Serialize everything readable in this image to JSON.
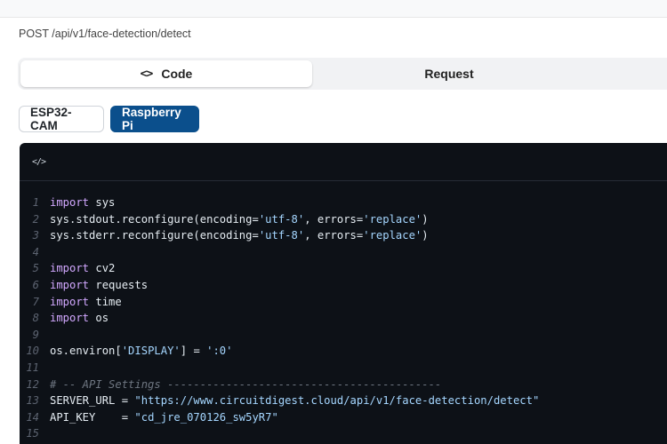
{
  "endpoint": "POST /api/v1/face-detection/detect",
  "tabs": {
    "code_icon": "<>",
    "code_label": "Code",
    "request_label": "Request"
  },
  "devices": {
    "esp32": "ESP32-CAM",
    "raspberry": "Raspberry Pi"
  },
  "code_header_icon": "</>",
  "colors": {
    "active_button": "#0b4f8c",
    "code_bg": "#0d1117",
    "keyword": "#d2a8ff",
    "string": "#a5d6ff"
  },
  "code": {
    "lines": [
      {
        "n": "1",
        "kw": "import",
        "rest": " sys"
      },
      {
        "n": "2",
        "a": "sys.stdout.reconfigure(encoding=",
        "s1": "'utf-8'",
        "b": ", errors=",
        "s2": "'replace'",
        "c": ")"
      },
      {
        "n": "3",
        "a": "sys.stderr.reconfigure(encoding=",
        "s1": "'utf-8'",
        "b": ", errors=",
        "s2": "'replace'",
        "c": ")"
      },
      {
        "n": "4"
      },
      {
        "n": "5",
        "kw": "import",
        "rest": " cv2"
      },
      {
        "n": "6",
        "kw": "import",
        "rest": " requests"
      },
      {
        "n": "7",
        "kw": "import",
        "rest": " time"
      },
      {
        "n": "8",
        "kw": "import",
        "rest": " os"
      },
      {
        "n": "9"
      },
      {
        "n": "10",
        "a": "os.environ[",
        "s1": "'DISPLAY'",
        "b": "] = ",
        "s2": "':0'",
        "c": ""
      },
      {
        "n": "11"
      },
      {
        "n": "12",
        "comment": "# -- API Settings ------------------------------------------"
      },
      {
        "n": "13",
        "a": "SERVER_URL = ",
        "s1": "\"https://www.circuitdigest.cloud/api/v1/face-detection/detect\"",
        "b": "",
        "s2": "",
        "c": ""
      },
      {
        "n": "14",
        "a": "API_KEY    = ",
        "s1": "\"cd_jre_070126_sw5yR7\"",
        "b": "",
        "s2": "",
        "c": ""
      },
      {
        "n": "15"
      }
    ]
  }
}
